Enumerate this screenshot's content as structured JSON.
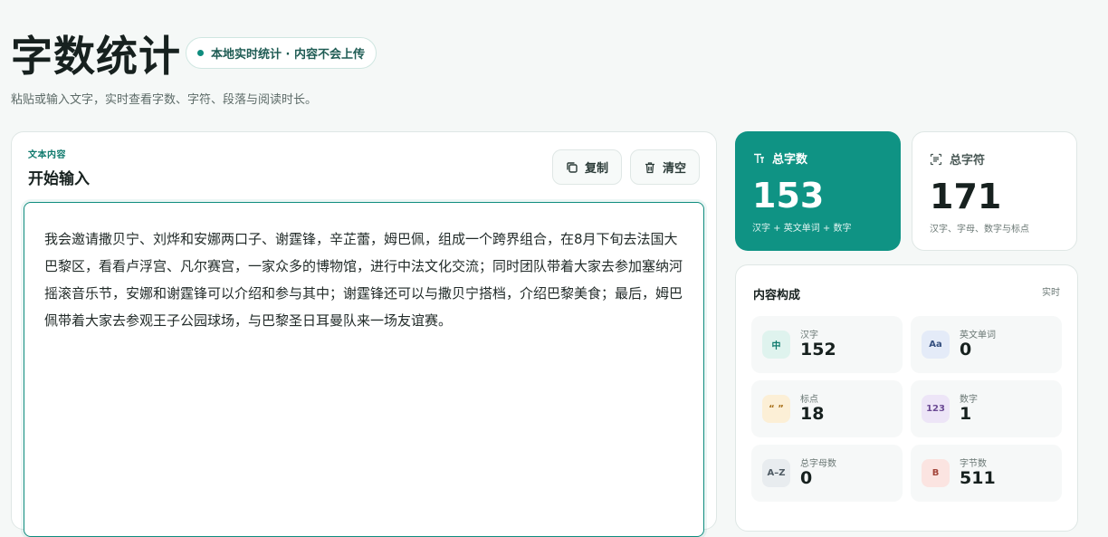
{
  "header": {
    "title": "字数统计",
    "badge": "本地实时统计 · 内容不会上传",
    "subtitle": "粘贴或输入文字，实时查看字数、字符、段落与阅读时长。"
  },
  "editor": {
    "kicker": "文本内容",
    "title": "开始输入",
    "copy_label": "复制",
    "clear_label": "清空",
    "text": "我会邀请撒贝宁、刘烨和安娜两口子、谢霆锋，辛芷蕾，姆巴佩，组成一个跨界组合，在8月下旬去法国大巴黎区，看看卢浮宫、凡尔赛宫，一家众多的博物馆，进行中法文化交流；同时团队带着大家去参加塞纳河摇滚音乐节，安娜和谢霆锋可以介绍和参与其中；谢霆锋还可以与撒贝宁搭档，介绍巴黎美食；最后，姆巴佩带着大家去参观王子公园球场，与巴黎圣日耳曼队来一场友谊赛。"
  },
  "stats": {
    "total_words": {
      "label": "总字数",
      "value": "153",
      "desc": "汉字 + 英文单词 + 数字"
    },
    "total_chars": {
      "label": "总字符",
      "value": "171",
      "desc": "汉字、字母、数字与标点"
    }
  },
  "breakdown": {
    "title": "内容构成",
    "tag": "实时",
    "items": [
      {
        "icon_text": "中",
        "label": "汉字",
        "value": "152",
        "bg": "#dff3ee",
        "fg": "#0f7a6d"
      },
      {
        "icon_text": "Aa",
        "label": "英文单词",
        "value": "0",
        "bg": "#e4ebf8",
        "fg": "#35507f"
      },
      {
        "icon_text": "“ ”",
        "label": "标点",
        "value": "18",
        "bg": "#fcefd6",
        "fg": "#a8701a"
      },
      {
        "icon_text": "123",
        "label": "数字",
        "value": "1",
        "bg": "#ede5f7",
        "fg": "#6c4b95"
      },
      {
        "icon_text": "A–Z",
        "label": "总字母数",
        "value": "0",
        "bg": "#e8ecef",
        "fg": "#4e5a63"
      },
      {
        "icon_text": "B",
        "label": "字节数",
        "value": "511",
        "bg": "#fbe4e1",
        "fg": "#a3453a"
      }
    ]
  },
  "colors": {
    "accent": "#0f9384",
    "accent_dark": "#0f7a6d",
    "page_bg": "#f5f8f7"
  }
}
